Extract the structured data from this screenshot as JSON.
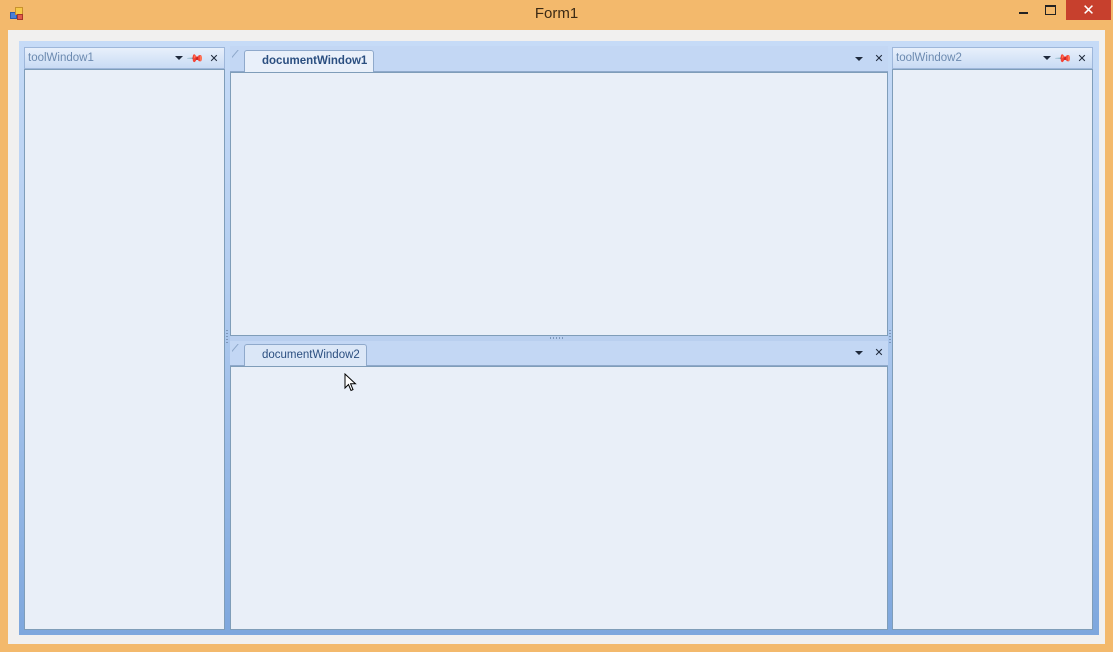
{
  "window": {
    "title": "Form1",
    "app_icon": "form-app-icon",
    "minimize_icon": "minimize-icon",
    "maximize_icon": "maximize-icon",
    "close_glyph": "✕"
  },
  "tool_windows": {
    "left": {
      "title": "toolWindow1"
    },
    "right": {
      "title": "toolWindow2"
    }
  },
  "documents": {
    "top": {
      "tab_label": "documentWindow1",
      "active": true
    },
    "bottom": {
      "tab_label": "documentWindow2",
      "active": false
    }
  },
  "header_glyphs": {
    "close": "✕",
    "pin": "📌"
  },
  "colors": {
    "titlebar": "#f3b96c",
    "close_button": "#c7402d",
    "panel_bg": "#e9eff8",
    "dock_bg": "#b3cdf0",
    "tab_text": "#2b4f80"
  }
}
